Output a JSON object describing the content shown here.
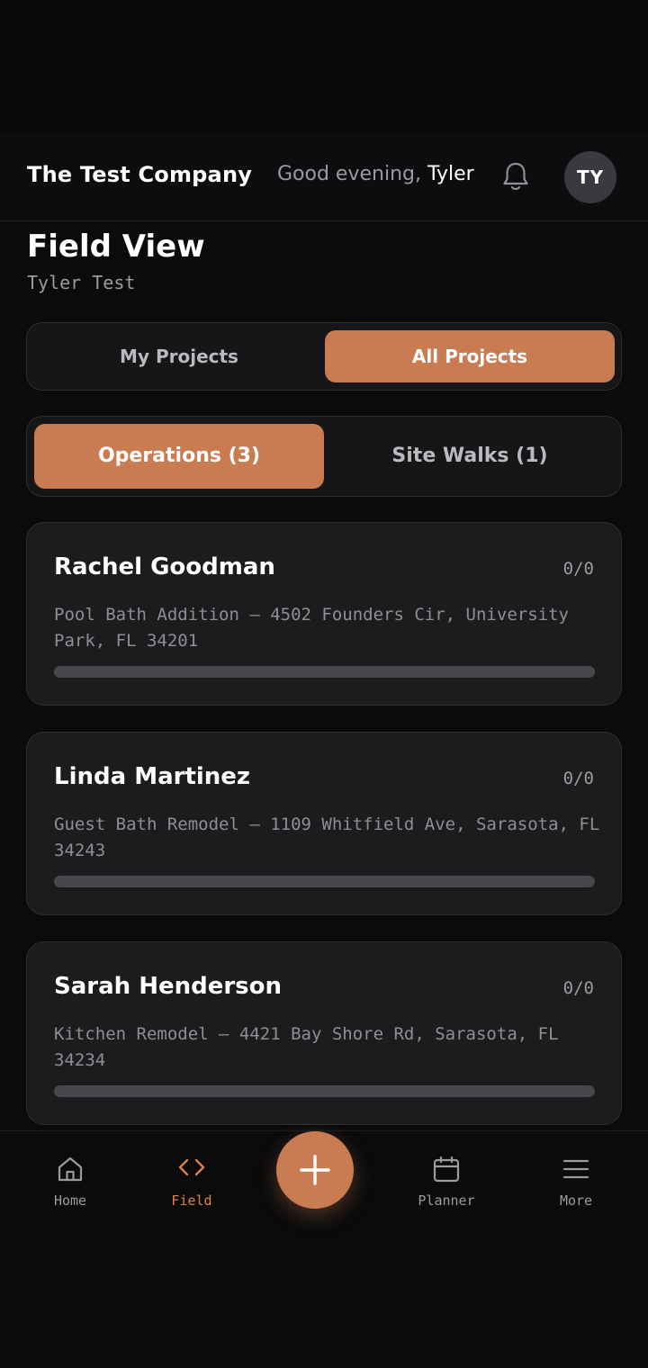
{
  "header": {
    "company_name": "The Test Company",
    "greeting_prefix": "Good evening,",
    "greeting_name": "Tyler",
    "avatar_initials": "TY"
  },
  "page": {
    "title": "Field View",
    "subtitle": "Tyler Test"
  },
  "project_filter": {
    "options": [
      {
        "label": "My Projects",
        "active": false
      },
      {
        "label": "All Projects",
        "active": true
      }
    ]
  },
  "category_tabs": {
    "options": [
      {
        "label": "Operations (3)",
        "active": true
      },
      {
        "label": "Site Walks (1)",
        "active": false
      }
    ]
  },
  "projects": [
    {
      "client": "Rachel Goodman",
      "count": "0/0",
      "description": "Pool Bath Addition — 4502 Founders Cir, University Park, FL 34201",
      "progress": 0
    },
    {
      "client": "Linda Martinez",
      "count": "0/0",
      "description": "Guest Bath Remodel — 1109 Whitfield Ave, Sarasota, FL 34243",
      "progress": 0
    },
    {
      "client": "Sarah Henderson",
      "count": "0/0",
      "description": "Kitchen Remodel — 4421 Bay Shore Rd, Sarasota, FL 34234",
      "progress": 0
    }
  ],
  "bottom_nav": {
    "items": [
      {
        "label": "Home",
        "icon": "home-icon",
        "active": false
      },
      {
        "label": "Field",
        "icon": "code-brackets-icon",
        "active": true
      },
      {
        "label": "Planner",
        "icon": "calendar-icon",
        "active": false
      },
      {
        "label": "More",
        "icon": "menu-icon",
        "active": false
      }
    ],
    "fab_icon": "plus-icon"
  },
  "colors": {
    "accent": "#c97b52",
    "background": "#0b0b0c",
    "card": "#1c1c1e",
    "progress_track": "#47474c",
    "muted_text": "#9b9ba0"
  }
}
